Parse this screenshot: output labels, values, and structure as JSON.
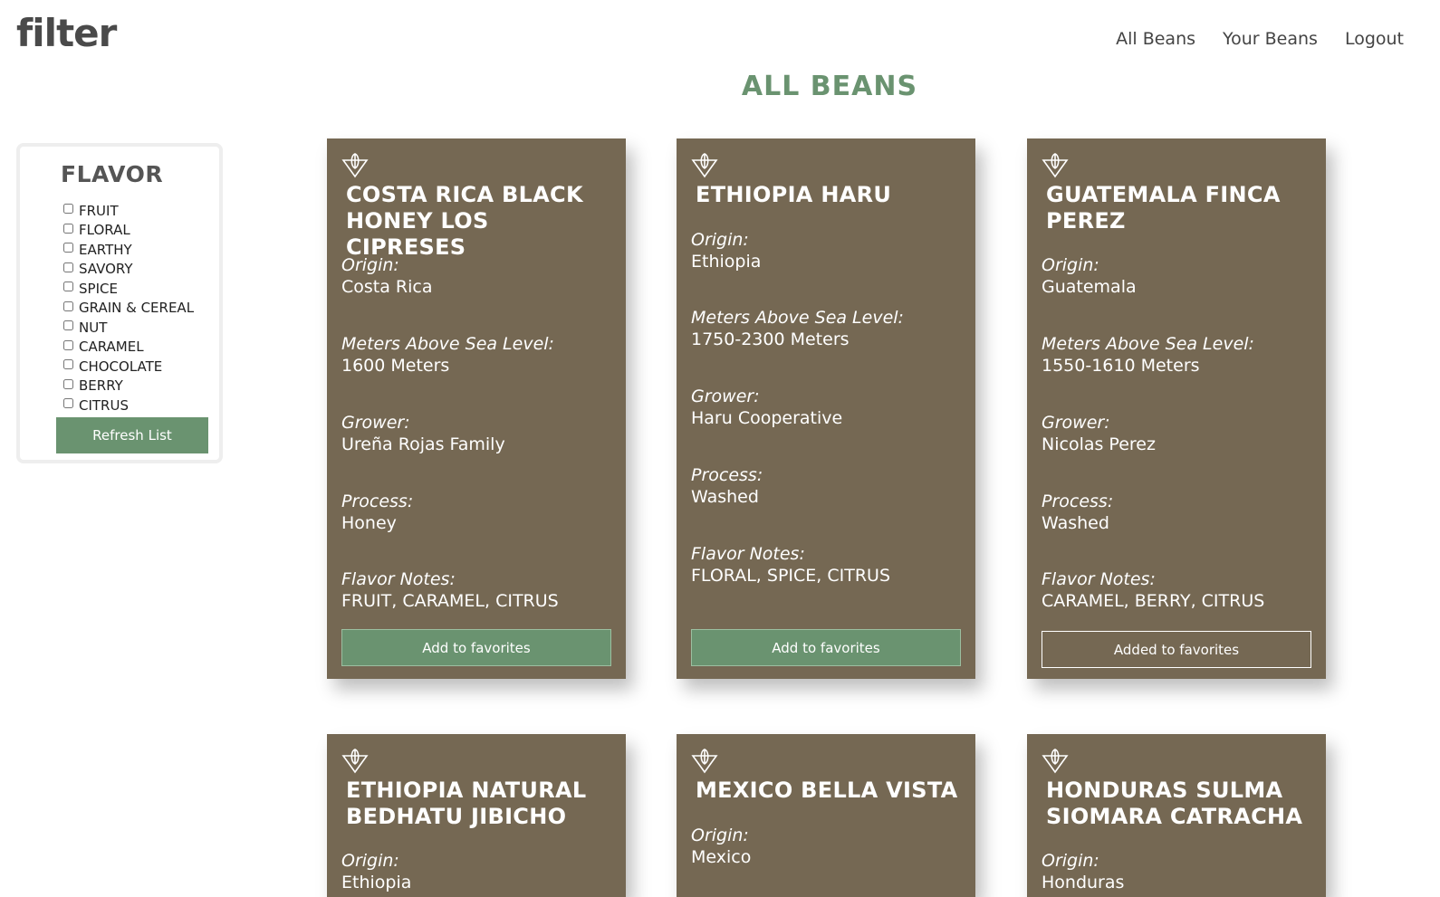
{
  "header": {
    "logo": "filter",
    "nav": [
      "All Beans",
      "Your Beans",
      "Logout"
    ]
  },
  "page_title": "ALL BEANS",
  "sidebar": {
    "title": "FLAVOR",
    "flavors": [
      "FRUIT",
      "FLORAL",
      "EARTHY",
      "SAVORY",
      "SPICE",
      "GRAIN & CEREAL",
      "NUT",
      "CARAMEL",
      "CHOCOLATE",
      "BERRY",
      "CITRUS"
    ],
    "refresh_label": "Refresh List"
  },
  "labels": {
    "origin": "Origin:",
    "altitude": "Meters Above Sea Level:",
    "grower": "Grower:",
    "process": "Process:",
    "flavor_notes": "Flavor Notes:"
  },
  "cards": [
    {
      "name": "COSTA RICA BLACK HONEY LOS CIPRESES",
      "origin": "Costa Rica",
      "altitude": "1600 Meters",
      "grower": "Ureña Rojas Family",
      "process": "Honey",
      "flavor_notes": "FRUIT, CARAMEL, CITRUS",
      "favorite_label": "Add to favorites",
      "favorited": false
    },
    {
      "name": "ETHIOPIA HARU",
      "origin": "Ethiopia",
      "altitude": "1750-2300 Meters",
      "grower": "Haru Cooperative",
      "process": "Washed",
      "flavor_notes": "FLORAL, SPICE, CITRUS",
      "favorite_label": "Add to favorites",
      "favorited": false
    },
    {
      "name": "GUATEMALA FINCA PEREZ",
      "origin": "Guatemala",
      "altitude": "1550-1610 Meters",
      "grower": "Nicolas Perez",
      "process": "Washed",
      "flavor_notes": "CARAMEL, BERRY, CITRUS",
      "favorite_label": "Added to favorites",
      "favorited": true
    },
    {
      "name": "ETHIOPIA NATURAL BEDHATU JIBICHO",
      "origin": "Ethiopia"
    },
    {
      "name": "MEXICO BELLA VISTA",
      "origin": "Mexico"
    },
    {
      "name": "HONDURAS SULMA SIOMARA CATRACHA",
      "origin": "Honduras"
    }
  ],
  "colors": {
    "accent": "#6a9370",
    "card_bg": "#756853"
  }
}
